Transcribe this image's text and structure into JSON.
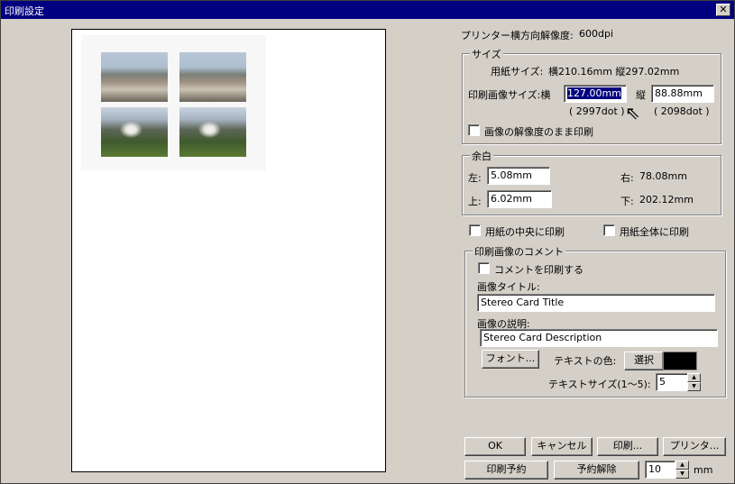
{
  "window": {
    "title": "印刷設定"
  },
  "resolution": {
    "label": "プリンター横方向解像度:",
    "value": "600dpi"
  },
  "size_group": {
    "title": "サイズ",
    "paper_label": "用紙サイズ:",
    "paper_value": "横210.16mm 縦297.02mm",
    "image_label": "印刷画像サイズ:横",
    "width_value": "127.00mm",
    "height_label": "縦",
    "height_value": "88.88mm",
    "width_dots": "( 2997dot )",
    "height_dots": "( 2098dot )",
    "keep_resolution_label": "画像の解像度のまま印刷"
  },
  "margin_group": {
    "title": "余白",
    "left_label": "左:",
    "left_value": "5.08mm",
    "right_label": "右:",
    "right_value": "78.08mm",
    "top_label": "上:",
    "top_value": "6.02mm",
    "bottom_label": "下:",
    "bottom_value": "202.12mm"
  },
  "options": {
    "center_label": "用紙の中央に印刷",
    "fit_label": "用紙全体に印刷"
  },
  "comment_group": {
    "title": "印刷画像のコメント",
    "print_comment_label": "コメントを印刷する",
    "title_label": "画像タイトル:",
    "title_value": "Stereo Card Title",
    "desc_label": "画像の説明:",
    "desc_value": "Stereo Card Description",
    "font_button": "フォント...",
    "text_color_label": "テキストの色:",
    "select_button": "選択",
    "text_color": "#000000",
    "text_size_label": "テキストサイズ(1〜5):",
    "text_size_value": "5"
  },
  "buttons": {
    "ok": "OK",
    "cancel": "キャンセル",
    "print": "印刷...",
    "printer": "プリンタ...",
    "reserve": "印刷予約",
    "unreserve": "予約解除",
    "spacing_value": "10",
    "spacing_unit": "mm"
  },
  "icons": {
    "close": "close-icon",
    "cursor": "arrow-cursor-icon"
  }
}
